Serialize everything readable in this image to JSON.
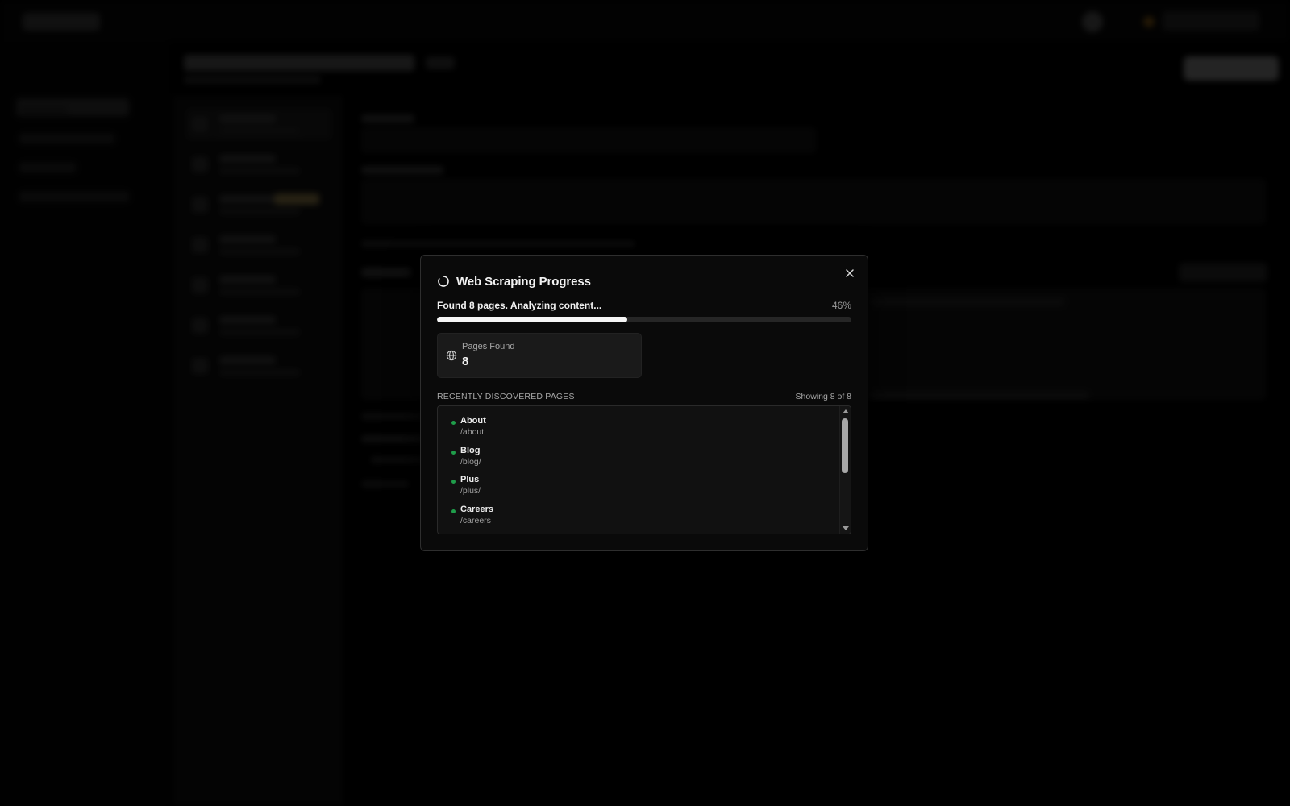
{
  "modal": {
    "title": "Web Scraping Progress",
    "status_text": "Found 8 pages. Analyzing content...",
    "progress_label": "46%",
    "progress_value": 0.46,
    "stat": {
      "label": "Pages Found",
      "value": "8"
    },
    "list_title": "RECENTLY DISCOVERED PAGES",
    "list_count": "Showing 8 of 8",
    "pages": [
      {
        "title": "About",
        "path": "/about"
      },
      {
        "title": "Blog",
        "path": "/blog/"
      },
      {
        "title": "Plus",
        "path": "/plus/"
      },
      {
        "title": "Careers",
        "path": "/careers"
      }
    ],
    "icons": {
      "loading": "spinner-icon",
      "close": "close-icon",
      "stat": "globe-icon",
      "status_dot": "status-dot-icon"
    },
    "colors": {
      "status_dot": "#1f9d4a",
      "progress_fill": "#f5f5f5",
      "modal_bg": "#0a0a0a"
    }
  }
}
